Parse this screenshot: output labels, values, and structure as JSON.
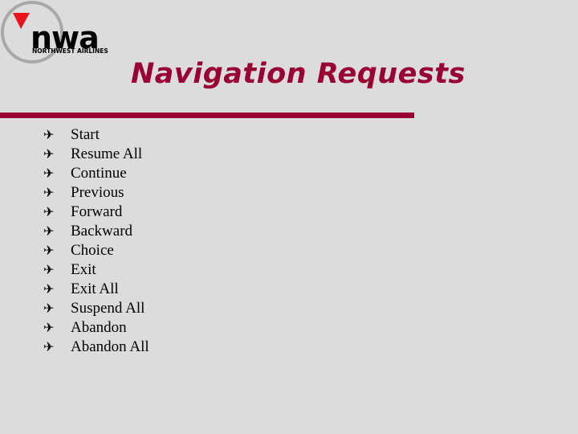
{
  "logo": {
    "wordmark": "nwa",
    "subtitle": "NORTHWEST AIRLINES",
    "accent_color": "#e8141e"
  },
  "slide": {
    "title": "Navigation Requests",
    "title_color": "#990033",
    "bullet_icon": "airplane-icon",
    "items": [
      {
        "label": "Start"
      },
      {
        "label": "Resume All"
      },
      {
        "label": "Continue"
      },
      {
        "label": "Previous"
      },
      {
        "label": "Forward"
      },
      {
        "label": "Backward"
      },
      {
        "label": "Choice"
      },
      {
        "label": "Exit"
      },
      {
        "label": "Exit All"
      },
      {
        "label": "Suspend All"
      },
      {
        "label": "Abandon"
      },
      {
        "label": "Abandon All"
      }
    ]
  }
}
